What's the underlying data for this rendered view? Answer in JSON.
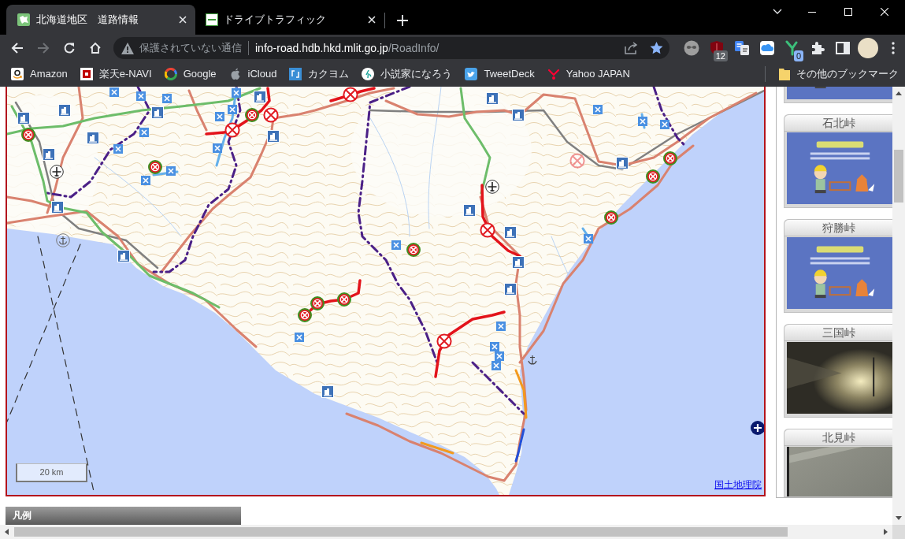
{
  "browser": {
    "tabs": [
      {
        "title": "北海道地区　道路情報",
        "selected": true,
        "kind": "map"
      },
      {
        "title": "ドライブトラフィック",
        "selected": false,
        "kind": "logo"
      }
    ],
    "navigation": {
      "back_enabled": true,
      "forward_enabled": false
    },
    "address_bar": {
      "security_warning": "保護されていない通信",
      "host": "info-road.hdb.hkd.mlit.go.jp",
      "path": "/RoadInfo/",
      "bookmarked": true
    },
    "extensions": [
      {
        "kind": "face"
      },
      {
        "kind": "shield",
        "badge": "12"
      },
      {
        "kind": "translate"
      },
      {
        "kind": "cloud"
      },
      {
        "kind": "fork",
        "badge": "0"
      }
    ],
    "bookmarks": [
      {
        "label": "Amazon",
        "kind": "amazon"
      },
      {
        "label": "楽天e-NAVI",
        "kind": "rakuten"
      },
      {
        "label": "Google",
        "kind": "google"
      },
      {
        "label": "iCloud",
        "kind": "apple"
      },
      {
        "label": "カクヨム",
        "kind": "kakuyomu"
      },
      {
        "label": "小説家になろう",
        "kind": "narou"
      },
      {
        "label": "TweetDeck",
        "kind": "twitter"
      },
      {
        "label": "Yahoo JAPAN",
        "kind": "yahoo"
      }
    ],
    "other_bookmarks": "その他のブックマーク"
  },
  "map": {
    "scale": "20 km",
    "attribution": "国土地理院"
  },
  "cameras": [
    {
      "kind": "maintenance"
    },
    {
      "title": "石北峠",
      "kind": "maintenance"
    },
    {
      "title": "狩勝峠",
      "kind": "maintenance"
    },
    {
      "title": "三国峠",
      "kind": "night"
    },
    {
      "title": "北見峠",
      "kind": "snow"
    }
  ],
  "legend": {
    "title": "凡例"
  }
}
